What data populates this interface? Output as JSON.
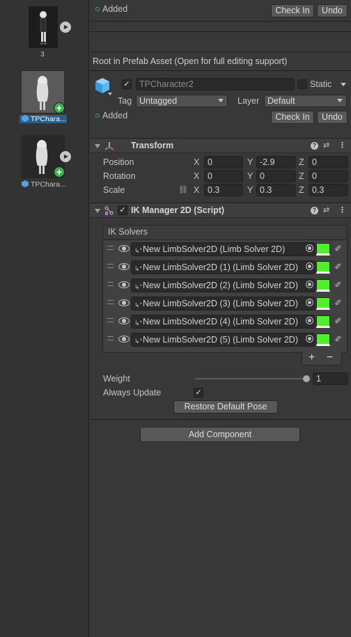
{
  "project_panel": {
    "items": [
      {
        "label": "3",
        "selected": false,
        "has_plus": false
      },
      {
        "label": "TPChara...",
        "selected": true,
        "has_plus": true
      },
      {
        "label": "TPChara...",
        "selected": false,
        "has_plus": true
      }
    ],
    "play_icon": "play-icon",
    "plus_symbol": "+"
  },
  "top_section": {
    "added_label": "Added",
    "check_in_label": "Check In",
    "undo_label": "Undo"
  },
  "prefab_notice": "Root in Prefab Asset (Open for full editing support)",
  "object_header": {
    "name": "TPCharacter2",
    "active_checked": true,
    "static_label": "Static",
    "static_checked": false,
    "tag_label": "Tag",
    "tag_value": "Untagged",
    "layer_label": "Layer",
    "layer_value": "Default",
    "added_label": "Added",
    "check_in_label": "Check In",
    "undo_label": "Undo"
  },
  "transform": {
    "title": "Transform",
    "rows": [
      {
        "label": "Position",
        "x": "0",
        "y": "-2.9",
        "z": "0"
      },
      {
        "label": "Rotation",
        "x": "0",
        "y": "0",
        "z": "0"
      },
      {
        "label": "Scale",
        "x": "0.3",
        "y": "0.3",
        "z": "0.3"
      }
    ],
    "axis_x": "X",
    "axis_y": "Y",
    "axis_z": "Z"
  },
  "ik_manager": {
    "title": "IK Manager 2D (Script)",
    "enabled": true,
    "solvers_label": "IK Solvers",
    "solvers": [
      {
        "name": "New LimbSolver2D (Limb Solver 2D)",
        "color": "#4ef02a"
      },
      {
        "name": "New LimbSolver2D (1) (Limb Solver 2D)",
        "color": "#4ef02a"
      },
      {
        "name": "New LimbSolver2D (2) (Limb Solver 2D)",
        "color": "#4ef02a"
      },
      {
        "name": "New LimbSolver2D (3) (Limb Solver 2D)",
        "color": "#4ef02a"
      },
      {
        "name": "New LimbSolver2D (4) (Limb Solver 2D)",
        "color": "#4ef02a"
      },
      {
        "name": "New LimbSolver2D (5) (Limb Solver 2D)",
        "color": "#4ef02a"
      }
    ],
    "add_symbol": "+",
    "remove_symbol": "−",
    "weight_label": "Weight",
    "weight_value": "1",
    "weight_fraction": 1,
    "always_update_label": "Always Update",
    "always_update_checked": true,
    "restore_label": "Restore Default Pose"
  },
  "add_component_label": "Add Component",
  "colors": {
    "accent": "#2c5d87",
    "plus_badge": "#3bb04a",
    "added_dot": "#3fae4b"
  }
}
